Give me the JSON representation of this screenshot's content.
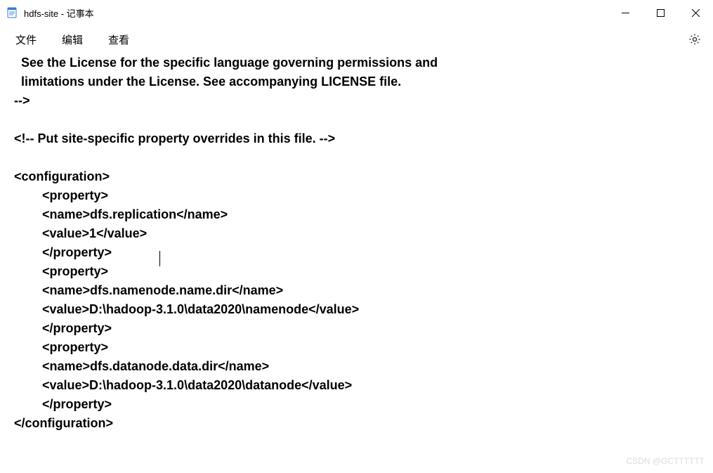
{
  "window": {
    "title": "hdfs-site - 记事本"
  },
  "menubar": {
    "file": "文件",
    "edit": "编辑",
    "view": "查看"
  },
  "editor": {
    "lines": [
      "  See the License for the specific language governing permissions and",
      "  limitations under the License. See accompanying LICENSE file.",
      "-->",
      "",
      "<!-- Put site-specific property overrides in this file. -->",
      "",
      "<configuration>",
      "        <property>",
      "        <name>dfs.replication</name>",
      "        <value>1</value>",
      "        </property>",
      "        <property>",
      "        <name>dfs.namenode.name.dir</name>",
      "        <value>D:\\hadoop-3.1.0\\data2020\\namenode</value>",
      "        </property>",
      "        <property>",
      "        <name>dfs.datanode.data.dir</name>",
      "        <value>D:\\hadoop-3.1.0\\data2020\\datanode</value>",
      "        </property>",
      "</configuration>"
    ]
  },
  "watermark": "CSDN @GCTTTTTT"
}
